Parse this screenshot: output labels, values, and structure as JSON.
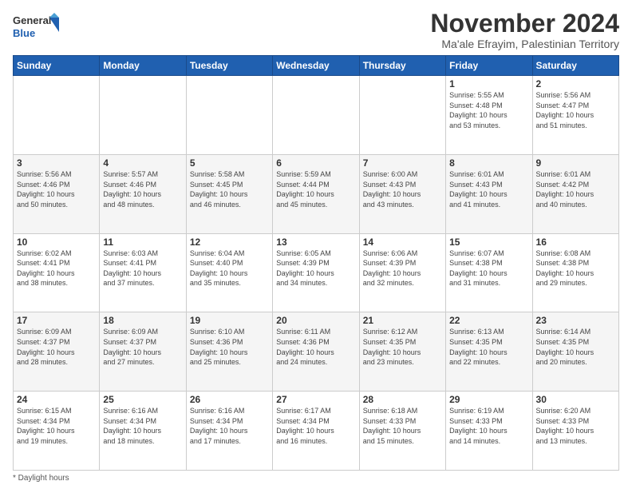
{
  "header": {
    "logo_line1": "General",
    "logo_line2": "Blue",
    "month_title": "November 2024",
    "location": "Ma'ale Efrayim, Palestinian Territory"
  },
  "footer": {
    "daylight_note": "Daylight hours"
  },
  "weekdays": [
    "Sunday",
    "Monday",
    "Tuesday",
    "Wednesday",
    "Thursday",
    "Friday",
    "Saturday"
  ],
  "weeks": [
    [
      {
        "day": "",
        "info": ""
      },
      {
        "day": "",
        "info": ""
      },
      {
        "day": "",
        "info": ""
      },
      {
        "day": "",
        "info": ""
      },
      {
        "day": "",
        "info": ""
      },
      {
        "day": "1",
        "info": "Sunrise: 5:55 AM\nSunset: 4:48 PM\nDaylight: 10 hours\nand 53 minutes."
      },
      {
        "day": "2",
        "info": "Sunrise: 5:56 AM\nSunset: 4:47 PM\nDaylight: 10 hours\nand 51 minutes."
      }
    ],
    [
      {
        "day": "3",
        "info": "Sunrise: 5:56 AM\nSunset: 4:46 PM\nDaylight: 10 hours\nand 50 minutes."
      },
      {
        "day": "4",
        "info": "Sunrise: 5:57 AM\nSunset: 4:46 PM\nDaylight: 10 hours\nand 48 minutes."
      },
      {
        "day": "5",
        "info": "Sunrise: 5:58 AM\nSunset: 4:45 PM\nDaylight: 10 hours\nand 46 minutes."
      },
      {
        "day": "6",
        "info": "Sunrise: 5:59 AM\nSunset: 4:44 PM\nDaylight: 10 hours\nand 45 minutes."
      },
      {
        "day": "7",
        "info": "Sunrise: 6:00 AM\nSunset: 4:43 PM\nDaylight: 10 hours\nand 43 minutes."
      },
      {
        "day": "8",
        "info": "Sunrise: 6:01 AM\nSunset: 4:43 PM\nDaylight: 10 hours\nand 41 minutes."
      },
      {
        "day": "9",
        "info": "Sunrise: 6:01 AM\nSunset: 4:42 PM\nDaylight: 10 hours\nand 40 minutes."
      }
    ],
    [
      {
        "day": "10",
        "info": "Sunrise: 6:02 AM\nSunset: 4:41 PM\nDaylight: 10 hours\nand 38 minutes."
      },
      {
        "day": "11",
        "info": "Sunrise: 6:03 AM\nSunset: 4:41 PM\nDaylight: 10 hours\nand 37 minutes."
      },
      {
        "day": "12",
        "info": "Sunrise: 6:04 AM\nSunset: 4:40 PM\nDaylight: 10 hours\nand 35 minutes."
      },
      {
        "day": "13",
        "info": "Sunrise: 6:05 AM\nSunset: 4:39 PM\nDaylight: 10 hours\nand 34 minutes."
      },
      {
        "day": "14",
        "info": "Sunrise: 6:06 AM\nSunset: 4:39 PM\nDaylight: 10 hours\nand 32 minutes."
      },
      {
        "day": "15",
        "info": "Sunrise: 6:07 AM\nSunset: 4:38 PM\nDaylight: 10 hours\nand 31 minutes."
      },
      {
        "day": "16",
        "info": "Sunrise: 6:08 AM\nSunset: 4:38 PM\nDaylight: 10 hours\nand 29 minutes."
      }
    ],
    [
      {
        "day": "17",
        "info": "Sunrise: 6:09 AM\nSunset: 4:37 PM\nDaylight: 10 hours\nand 28 minutes."
      },
      {
        "day": "18",
        "info": "Sunrise: 6:09 AM\nSunset: 4:37 PM\nDaylight: 10 hours\nand 27 minutes."
      },
      {
        "day": "19",
        "info": "Sunrise: 6:10 AM\nSunset: 4:36 PM\nDaylight: 10 hours\nand 25 minutes."
      },
      {
        "day": "20",
        "info": "Sunrise: 6:11 AM\nSunset: 4:36 PM\nDaylight: 10 hours\nand 24 minutes."
      },
      {
        "day": "21",
        "info": "Sunrise: 6:12 AM\nSunset: 4:35 PM\nDaylight: 10 hours\nand 23 minutes."
      },
      {
        "day": "22",
        "info": "Sunrise: 6:13 AM\nSunset: 4:35 PM\nDaylight: 10 hours\nand 22 minutes."
      },
      {
        "day": "23",
        "info": "Sunrise: 6:14 AM\nSunset: 4:35 PM\nDaylight: 10 hours\nand 20 minutes."
      }
    ],
    [
      {
        "day": "24",
        "info": "Sunrise: 6:15 AM\nSunset: 4:34 PM\nDaylight: 10 hours\nand 19 minutes."
      },
      {
        "day": "25",
        "info": "Sunrise: 6:16 AM\nSunset: 4:34 PM\nDaylight: 10 hours\nand 18 minutes."
      },
      {
        "day": "26",
        "info": "Sunrise: 6:16 AM\nSunset: 4:34 PM\nDaylight: 10 hours\nand 17 minutes."
      },
      {
        "day": "27",
        "info": "Sunrise: 6:17 AM\nSunset: 4:34 PM\nDaylight: 10 hours\nand 16 minutes."
      },
      {
        "day": "28",
        "info": "Sunrise: 6:18 AM\nSunset: 4:33 PM\nDaylight: 10 hours\nand 15 minutes."
      },
      {
        "day": "29",
        "info": "Sunrise: 6:19 AM\nSunset: 4:33 PM\nDaylight: 10 hours\nand 14 minutes."
      },
      {
        "day": "30",
        "info": "Sunrise: 6:20 AM\nSunset: 4:33 PM\nDaylight: 10 hours\nand 13 minutes."
      }
    ]
  ]
}
